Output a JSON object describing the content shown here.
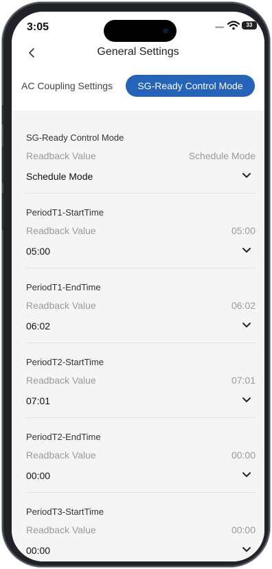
{
  "status_bar": {
    "time": "3:05",
    "battery": "33"
  },
  "nav": {
    "title": "General Settings"
  },
  "tabs": [
    {
      "label": "AC Coupling Settings",
      "active": false
    },
    {
      "label": "SG-Ready Control Mode",
      "active": true
    }
  ],
  "colors": {
    "accent": "#2563b8",
    "background": "#f5f5f5"
  },
  "settings": [
    {
      "label": "SG-Ready Control Mode",
      "readback_label": "Readback Value",
      "readback_value": "Schedule Mode",
      "value": "Schedule Mode"
    },
    {
      "label": "PeriodT1-StartTime",
      "readback_label": "Readback Value",
      "readback_value": "05:00",
      "value": "05:00"
    },
    {
      "label": "PeriodT1-EndTime",
      "readback_label": "Readback Value",
      "readback_value": "06:02",
      "value": "06:02"
    },
    {
      "label": "PeriodT2-StartTime",
      "readback_label": "Readback Value",
      "readback_value": "07:01",
      "value": "07:01"
    },
    {
      "label": "PeriodT2-EndTime",
      "readback_label": "Readback Value",
      "readback_value": "00:00",
      "value": "00:00"
    },
    {
      "label": "PeriodT3-StartTime",
      "readback_label": "Readback Value",
      "readback_value": "00:00",
      "value": "00:00"
    }
  ]
}
